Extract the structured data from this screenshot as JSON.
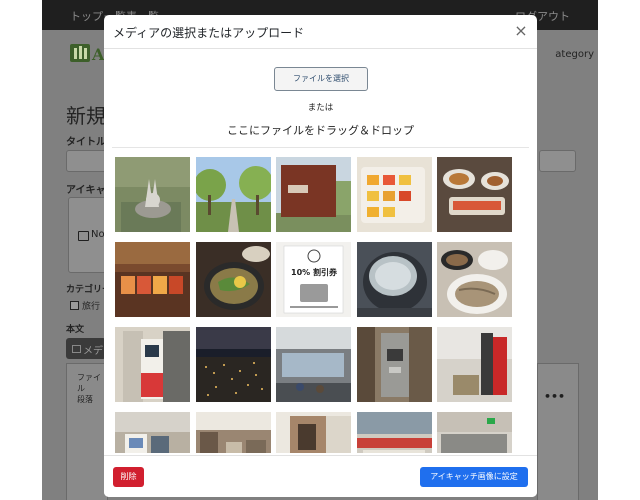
{
  "background_page": {
    "nav": [
      "トップ",
      "一覧表一覧",
      "ログアウト"
    ],
    "heading": "新規",
    "title_label": "タイトル",
    "eyecatch_label": "アイキャ",
    "eyecatch_placeholder": "No",
    "category_label": "カテゴリー",
    "category_option": "旅行",
    "body_label": "本文",
    "media_button": "メデ",
    "editor_rows": [
      "ファイル",
      "段落"
    ],
    "category_link": "ategory"
  },
  "modal": {
    "title": "メディアの選択またはアップロード",
    "close_symbol": "×",
    "file_select_label": "ファイルを選択",
    "or_text": "または",
    "drop_text": "ここにファイルをドラッグ＆ドロップ",
    "delete_label": "削除",
    "set_eyecatch_label": "アイキャッチ画像に設定"
  },
  "media_images": [
    {
      "subject": "rabbit statue",
      "coupon_line1": "",
      "coupon_line2": ""
    },
    {
      "subject": "tree-lined path",
      "coupon_line1": "",
      "coupon_line2": ""
    },
    {
      "subject": "building sign",
      "coupon_line1": "",
      "coupon_line2": ""
    },
    {
      "subject": "dessert tray",
      "coupon_line1": "",
      "coupon_line2": ""
    },
    {
      "subject": "food dishes",
      "coupon_line1": "",
      "coupon_line2": ""
    },
    {
      "subject": "souvenir shop",
      "coupon_line1": "",
      "coupon_line2": ""
    },
    {
      "subject": "noodle bowl",
      "coupon_line1": "",
      "coupon_line2": ""
    },
    {
      "subject": "coupon flyer",
      "coupon_line1": "10% 割引券",
      "coupon_line2": ""
    },
    {
      "subject": "pot of water",
      "coupon_line1": "",
      "coupon_line2": ""
    },
    {
      "subject": "soba dishes",
      "coupon_line1": "",
      "coupon_line2": ""
    },
    {
      "subject": "ticket machine",
      "coupon_line1": "",
      "coupon_line2": ""
    },
    {
      "subject": "night view",
      "coupon_line1": "",
      "coupon_line2": ""
    },
    {
      "subject": "terminal interior",
      "coupon_line1": "",
      "coupon_line2": ""
    },
    {
      "subject": "payphone",
      "coupon_line1": "",
      "coupon_line2": ""
    },
    {
      "subject": "vending machine",
      "coupon_line1": "",
      "coupon_line2": ""
    },
    {
      "subject": "restroom",
      "coupon_line1": "",
      "coupon_line2": ""
    },
    {
      "subject": "cafe interior",
      "coupon_line1": "",
      "coupon_line2": ""
    },
    {
      "subject": "corridor",
      "coupon_line1": "",
      "coupon_line2": ""
    },
    {
      "subject": "shop interior",
      "coupon_line1": "",
      "coupon_line2": ""
    },
    {
      "subject": "building exterior",
      "coupon_line1": "",
      "coupon_line2": ""
    }
  ],
  "colors": {
    "primary": "#1f6fee",
    "danger": "#d11f2f",
    "overlay_page": "#808080",
    "navbar": "#1f1f1f"
  }
}
